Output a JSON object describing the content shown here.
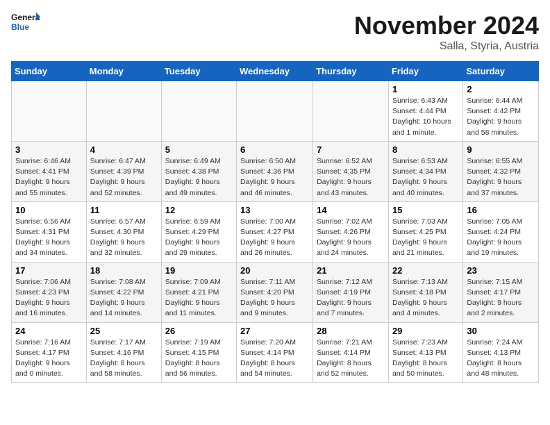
{
  "logo": {
    "text_general": "General",
    "text_blue": "Blue"
  },
  "header": {
    "month_year": "November 2024",
    "location": "Salla, Styria, Austria"
  },
  "weekdays": [
    "Sunday",
    "Monday",
    "Tuesday",
    "Wednesday",
    "Thursday",
    "Friday",
    "Saturday"
  ],
  "weeks": [
    {
      "days": [
        {
          "number": "",
          "info": ""
        },
        {
          "number": "",
          "info": ""
        },
        {
          "number": "",
          "info": ""
        },
        {
          "number": "",
          "info": ""
        },
        {
          "number": "",
          "info": ""
        },
        {
          "number": "1",
          "info": "Sunrise: 6:43 AM\nSunset: 4:44 PM\nDaylight: 10 hours and 1 minute."
        },
        {
          "number": "2",
          "info": "Sunrise: 6:44 AM\nSunset: 4:42 PM\nDaylight: 9 hours and 58 minutes."
        }
      ]
    },
    {
      "days": [
        {
          "number": "3",
          "info": "Sunrise: 6:46 AM\nSunset: 4:41 PM\nDaylight: 9 hours and 55 minutes."
        },
        {
          "number": "4",
          "info": "Sunrise: 6:47 AM\nSunset: 4:39 PM\nDaylight: 9 hours and 52 minutes."
        },
        {
          "number": "5",
          "info": "Sunrise: 6:49 AM\nSunset: 4:38 PM\nDaylight: 9 hours and 49 minutes."
        },
        {
          "number": "6",
          "info": "Sunrise: 6:50 AM\nSunset: 4:36 PM\nDaylight: 9 hours and 46 minutes."
        },
        {
          "number": "7",
          "info": "Sunrise: 6:52 AM\nSunset: 4:35 PM\nDaylight: 9 hours and 43 minutes."
        },
        {
          "number": "8",
          "info": "Sunrise: 6:53 AM\nSunset: 4:34 PM\nDaylight: 9 hours and 40 minutes."
        },
        {
          "number": "9",
          "info": "Sunrise: 6:55 AM\nSunset: 4:32 PM\nDaylight: 9 hours and 37 minutes."
        }
      ]
    },
    {
      "days": [
        {
          "number": "10",
          "info": "Sunrise: 6:56 AM\nSunset: 4:31 PM\nDaylight: 9 hours and 34 minutes."
        },
        {
          "number": "11",
          "info": "Sunrise: 6:57 AM\nSunset: 4:30 PM\nDaylight: 9 hours and 32 minutes."
        },
        {
          "number": "12",
          "info": "Sunrise: 6:59 AM\nSunset: 4:29 PM\nDaylight: 9 hours and 29 minutes."
        },
        {
          "number": "13",
          "info": "Sunrise: 7:00 AM\nSunset: 4:27 PM\nDaylight: 9 hours and 26 minutes."
        },
        {
          "number": "14",
          "info": "Sunrise: 7:02 AM\nSunset: 4:26 PM\nDaylight: 9 hours and 24 minutes."
        },
        {
          "number": "15",
          "info": "Sunrise: 7:03 AM\nSunset: 4:25 PM\nDaylight: 9 hours and 21 minutes."
        },
        {
          "number": "16",
          "info": "Sunrise: 7:05 AM\nSunset: 4:24 PM\nDaylight: 9 hours and 19 minutes."
        }
      ]
    },
    {
      "days": [
        {
          "number": "17",
          "info": "Sunrise: 7:06 AM\nSunset: 4:23 PM\nDaylight: 9 hours and 16 minutes."
        },
        {
          "number": "18",
          "info": "Sunrise: 7:08 AM\nSunset: 4:22 PM\nDaylight: 9 hours and 14 minutes."
        },
        {
          "number": "19",
          "info": "Sunrise: 7:09 AM\nSunset: 4:21 PM\nDaylight: 9 hours and 11 minutes."
        },
        {
          "number": "20",
          "info": "Sunrise: 7:11 AM\nSunset: 4:20 PM\nDaylight: 9 hours and 9 minutes."
        },
        {
          "number": "21",
          "info": "Sunrise: 7:12 AM\nSunset: 4:19 PM\nDaylight: 9 hours and 7 minutes."
        },
        {
          "number": "22",
          "info": "Sunrise: 7:13 AM\nSunset: 4:18 PM\nDaylight: 9 hours and 4 minutes."
        },
        {
          "number": "23",
          "info": "Sunrise: 7:15 AM\nSunset: 4:17 PM\nDaylight: 9 hours and 2 minutes."
        }
      ]
    },
    {
      "days": [
        {
          "number": "24",
          "info": "Sunrise: 7:16 AM\nSunset: 4:17 PM\nDaylight: 9 hours and 0 minutes."
        },
        {
          "number": "25",
          "info": "Sunrise: 7:17 AM\nSunset: 4:16 PM\nDaylight: 8 hours and 58 minutes."
        },
        {
          "number": "26",
          "info": "Sunrise: 7:19 AM\nSunset: 4:15 PM\nDaylight: 8 hours and 56 minutes."
        },
        {
          "number": "27",
          "info": "Sunrise: 7:20 AM\nSunset: 4:14 PM\nDaylight: 8 hours and 54 minutes."
        },
        {
          "number": "28",
          "info": "Sunrise: 7:21 AM\nSunset: 4:14 PM\nDaylight: 8 hours and 52 minutes."
        },
        {
          "number": "29",
          "info": "Sunrise: 7:23 AM\nSunset: 4:13 PM\nDaylight: 8 hours and 50 minutes."
        },
        {
          "number": "30",
          "info": "Sunrise: 7:24 AM\nSunset: 4:13 PM\nDaylight: 8 hours and 48 minutes."
        }
      ]
    }
  ]
}
